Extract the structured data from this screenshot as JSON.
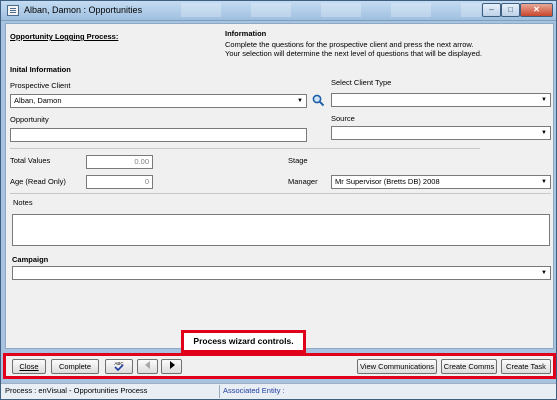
{
  "window": {
    "title": "Alban, Damon : Opportunities",
    "controls": {
      "minimize": "–",
      "maximize": "□",
      "close": "✕"
    }
  },
  "header": {
    "process_title": "Opportunity Logging Process:",
    "info_heading": "Information",
    "info_line1": "Complete the questions for the prospective client and press the next arrow.",
    "info_line2": "Your selection will determine the next level of questions that will be displayed."
  },
  "form": {
    "section_title": "Inital Information",
    "prospective_client": {
      "label": "Prospective Client",
      "value": "Alban, Damon"
    },
    "client_type": {
      "label": "Select Client Type",
      "value": ""
    },
    "opportunity": {
      "label": "Opportunity",
      "value": ""
    },
    "source": {
      "label": "Source",
      "value": ""
    },
    "total_values": {
      "label": "Total Values",
      "value": "0.00"
    },
    "age": {
      "label": "Age (Read Only)",
      "value": "0"
    },
    "stage": {
      "label": "Stage"
    },
    "manager": {
      "label": "Manager",
      "value": "Mr Supervisor (Bretts DB) 2008"
    },
    "notes": {
      "label": "Notes",
      "value": ""
    },
    "campaign": {
      "label": "Campaign",
      "value": ""
    }
  },
  "callout": {
    "text": "Process wizard controls."
  },
  "wizard": {
    "close": "Close",
    "complete": "Complete",
    "spellcheck": "ABC",
    "view_communications": "View Communications",
    "create_comms": "Create Comms",
    "create_task": "Create Task"
  },
  "status": {
    "process": "Process : enVisual - Opportunities Process",
    "associated_entity": "Associated Entity :"
  },
  "colors": {
    "callout_border": "#e0001b",
    "link_blue": "#1f3f9f"
  },
  "icons": [
    "search-icon",
    "chevron-down-icon",
    "spellcheck-icon",
    "back-arrow-icon",
    "next-arrow-icon"
  ]
}
